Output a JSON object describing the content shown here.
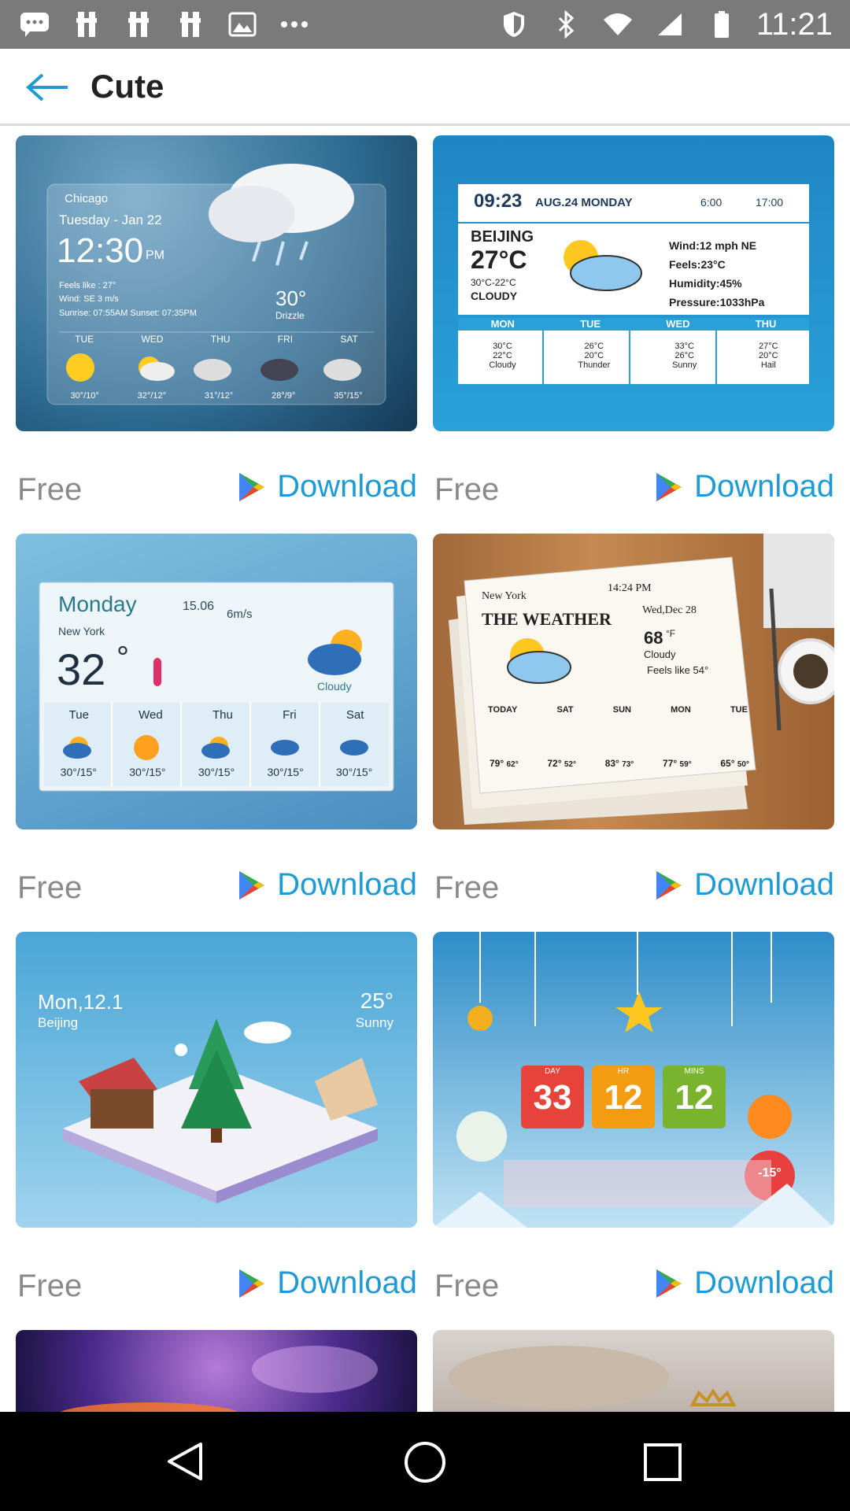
{
  "status_bar": {
    "time": "11:21",
    "icons_left": [
      "chat-icon",
      "notification-icon",
      "notification-icon",
      "notification-icon",
      "image-icon",
      "more-icon"
    ],
    "icons_right": [
      "shield-icon",
      "bluetooth-icon",
      "wifi-icon",
      "signal-icon",
      "battery-icon"
    ]
  },
  "header": {
    "title": "Cute",
    "back_icon": "back-arrow-icon"
  },
  "cards": [
    {
      "price": "Free",
      "download": "Download",
      "preview": {
        "city": "Chicago",
        "date": "Tuesday - Jan 22",
        "time": "12:30",
        "ampm": "PM",
        "feels": "Feels like : 27°",
        "wind": "Wind: SE 3 m/s",
        "sun": "Sunrise: 07:55AM   Sunset: 07:35PM",
        "temp": "30°",
        "cond": "Drizzle",
        "days": [
          "TUE",
          "WED",
          "THU",
          "FRI",
          "SAT"
        ],
        "temps": [
          "30°/10°",
          "32°/12°",
          "31°/12°",
          "28°/9°",
          "35°/15°"
        ]
      }
    },
    {
      "price": "Free",
      "download": "Download",
      "preview": {
        "time": "09:23",
        "date": "AUG.24  MONDAY",
        "sunrise": "6:00",
        "sunset": "17:00",
        "city": "BEIJING",
        "temp": "27°C",
        "range": "30°C-22°C",
        "cond": "CLOUDY",
        "wind": "Wind:12 mph NE",
        "feels": "Feels:23°C",
        "humidity": "Humidity:45%",
        "pressure": "Pressure:1033hPa",
        "days": [
          "MON",
          "TUE",
          "WED",
          "THU"
        ],
        "hi": [
          "30°C",
          "26°C",
          "33°C",
          "27°C"
        ],
        "lo": [
          "22°C",
          "20°C",
          "26°C",
          "20°C"
        ],
        "conds": [
          "Cloudy",
          "Thunder",
          "Sunny",
          "Hail"
        ]
      }
    },
    {
      "price": "Free",
      "download": "Download",
      "preview": {
        "day": "Monday",
        "date": "15.06",
        "wind": "6m/s",
        "city": "New York",
        "temp": "32",
        "deg": "°",
        "cond": "Cloudy",
        "days": [
          "Tue",
          "Wed",
          "Thu",
          "Fri",
          "Sat"
        ],
        "temps": [
          "30°/15°",
          "30°/15°",
          "30°/15°",
          "30°/15°",
          "30°/15°"
        ]
      }
    },
    {
      "price": "Free",
      "download": "Download",
      "preview": {
        "city": "New York",
        "time": "14:24 PM",
        "title": "THE WEATHER",
        "date": "Wed,Dec 28",
        "temp": "68",
        "unit": "°F",
        "cond": "Cloudy",
        "feels": "Feels like  54°",
        "days": [
          "TODAY",
          "SAT",
          "SUN",
          "MON",
          "TUE"
        ],
        "temps": [
          "79°",
          "72°",
          "83°",
          "77°",
          "65°"
        ],
        "lows": [
          "62°",
          "52°",
          "73°",
          "59°",
          "50°"
        ]
      }
    },
    {
      "price": "Free",
      "download": "Download",
      "preview": {
        "date": "Mon,12.1",
        "city": "Beijing",
        "temp": "25°",
        "cond": "Sunny"
      }
    },
    {
      "price": "Free",
      "download": "Download",
      "preview": {
        "day_label": "DAY",
        "day": "33",
        "hr_label": "HR",
        "hr": "12",
        "min_label": "MINS",
        "min": "12",
        "temp": "-15°"
      }
    },
    {
      "price": "",
      "download": ""
    },
    {
      "price": "",
      "download": ""
    }
  ],
  "nav_bar": {
    "back": "nav-back-icon",
    "home": "nav-home-icon",
    "recents": "nav-recents-icon"
  },
  "colors": {
    "accent": "#1e9bd6",
    "status_bar": "#7a7a7a",
    "nav_bar": "#000000",
    "free_text": "#8a8a8a"
  }
}
